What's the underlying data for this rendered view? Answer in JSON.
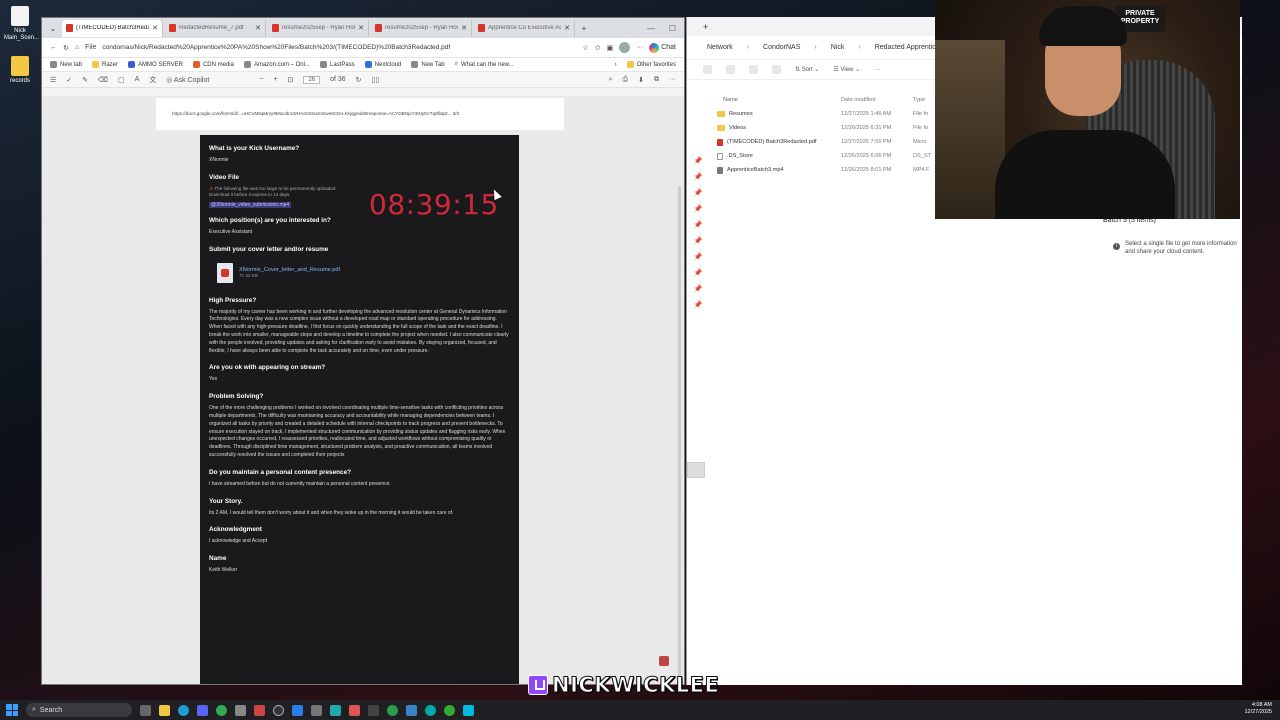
{
  "desktop": {
    "icons": [
      {
        "label": "Nick Main_Scen..."
      },
      {
        "label": "records"
      }
    ]
  },
  "browser": {
    "tabs": [
      {
        "title": "(TIMECODED) Batch3Redacted",
        "active": true
      },
      {
        "title": "RedactedResume_7.pdf",
        "active": false
      },
      {
        "title": "resume2025sep - Ryan Hon",
        "active": false
      },
      {
        "title": "resume2025sep - Ryan Hon",
        "active": false
      },
      {
        "title": "Apprentice Co Executive Ass",
        "active": false
      }
    ],
    "url": "condornas/Nick/Redacted%20Apprentice%20PA%20Show%20Files/Batch%203/(TIMECODED)%20Batch3Redacted.pdf",
    "url_prefix": "File",
    "chat_label": "Chat",
    "favorites": [
      {
        "label": "New tab"
      },
      {
        "label": "Razer"
      },
      {
        "label": "AMMO SERVER"
      },
      {
        "label": "CDN media"
      },
      {
        "label": "Amazon.com – Onl..."
      },
      {
        "label": "LastPass"
      },
      {
        "label": "Nextcloud"
      },
      {
        "label": "New Tab"
      },
      {
        "label": "What can the new..."
      }
    ],
    "other_favorites": "Other favorites",
    "pdf_toolbar": {
      "ask_copilot": "Ask Copilot",
      "page_current": "26",
      "page_total": "of 36"
    }
  },
  "pdf": {
    "url_strip": "https://docs.google.com/forms/d/...uHCVM6qMmy9MuUdr13zHAm3GsxmGwe5CNo-kXjqg/edit#response=ACYDBNjoY3INy5VTq8fidp3...          3/3",
    "timer": "08:39:15",
    "q_username": "What is your Kick Username?",
    "a_username": "XNormie",
    "q_video": "Video File",
    "video_warning_1": "The following file was too large to be permanently uploaded.",
    "video_warning_2": "Download it before it expires in 14 days.",
    "video_link": "@XNormie_video_submission.mp4",
    "q_position": "Which position(s) are you interested in?",
    "a_position": "Executive Assistant",
    "q_cover": "Submit your cover letter and/or resume",
    "cover_file": "XNormie_Cover_letter_and_Resume.pdf",
    "cover_size": "77.42 KB",
    "q_pressure": "High Pressure?",
    "a_pressure": "The majority of my career has been working in and further developing the advanced resolution center at General Dynamics Information Technologies. Every day was a new complex issue without a developed road map or standard operating procedure for addressing. When faced with any high-pressure deadline, I first focus on quickly understanding the full scope of the task and the exact deadline. I break the work into smaller, manageable steps and develop a timeline to complete the project when needed. I also communicate clearly with the people involved, providing updates and asking for clarification early to avoid mistakes. By staying organized, focused, and flexible, I have always been able to complete the task accurately and on time, even under pressure.",
    "q_stream": "Are you ok with appearing on stream?",
    "a_stream": "Yes",
    "q_problem": "Problem Solving?",
    "a_problem": "One of the more challenging problems I worked on involved coordinating multiple time-sensitive tasks with conflicting priorities across multiple departments. The difficulty was maintaining accuracy and accountability while managing dependencies between teams. I organized all tasks by priority and created a detailed schedule with internal checkpoints to track progress and prevent bottlenecks. To ensure execution stayed on track, I implemented structured communication by providing status updates and flagging risks early. When unexpected changes occurred, I reassessed priorities, reallocated time, and adjusted workflows without compromising quality or deadlines. Through disciplined time management, structured problem analysis, and proactive communication, all teams involved successfully resolved the issues and completed their projects",
    "q_presence": "Do you maintain a personal content presence?",
    "a_presence": "I have streamed before but do not currently maintain a personal content presence.",
    "q_story": "Your Story.",
    "a_story": "Its 2 AM, I would tell them don't worry about it and  when they woke up in the morning it would be taken care of.",
    "q_ack": "Acknowledgment",
    "a_ack": "I acknowledge and Accept",
    "q_name": "Name",
    "a_name": "Keith Welker"
  },
  "explorer": {
    "breadcrumb": [
      "Network",
      "CondorNAS",
      "Nick",
      "Redacted Apprentice PA Show"
    ],
    "sort_label": "Sort",
    "view_label": "View",
    "columns": {
      "name": "Name",
      "date": "Date modified",
      "type": "Type"
    },
    "files": [
      {
        "name": "Resumes",
        "date": "12/27/2025 1:46 AM",
        "type": "File fo",
        "kind": "folder"
      },
      {
        "name": "Videos",
        "date": "12/26/2025 6:31 PM",
        "type": "File fo",
        "kind": "folder"
      },
      {
        "name": "(TIMECODED) Batch3Redacted.pdf",
        "date": "12/27/2025 7:55 PM",
        "type": "Micro",
        "kind": "pdf"
      },
      {
        "name": ".DS_Store",
        "date": "12/26/2025 6:06 PM",
        "type": "DS_ST",
        "kind": "generic"
      },
      {
        "name": "ApprenticeBatch3.mp4",
        "date": "12/26/2025 8:01 PM",
        "type": "MP4 F",
        "kind": "video"
      }
    ],
    "details_title": "Batch 3 (5 items)",
    "details_info": "Select a single file to get more information and share your cloud content."
  },
  "overlay": {
    "twitch_name": "NICKWICKLEE",
    "poster_text": "PRIVATE PROPERTY"
  },
  "taskbar": {
    "search_placeholder": "Search",
    "time": "4:08 AM",
    "date": "12/27/2025"
  },
  "colors": {
    "timer": "#d0283b",
    "twitch": "#9146ff",
    "form_bg": "#1a1a1c"
  }
}
